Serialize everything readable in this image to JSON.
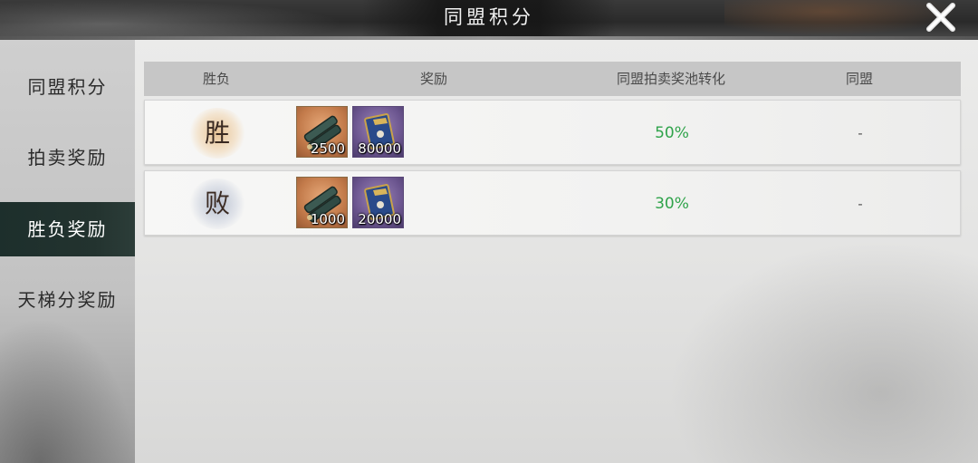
{
  "window": {
    "title": "同盟积分",
    "close_icon": "close-x-icon"
  },
  "sidebar": {
    "items": [
      {
        "label": "同盟积分",
        "active": false
      },
      {
        "label": "拍卖奖励",
        "active": false
      },
      {
        "label": "胜负奖励",
        "active": true
      },
      {
        "label": "天梯分奖励",
        "active": false
      }
    ]
  },
  "table": {
    "headers": [
      "胜负",
      "奖励",
      "同盟拍卖奖池转化",
      "同盟"
    ],
    "rows": [
      {
        "result": "胜",
        "rewards": [
          {
            "icon": "scroll-icon",
            "quantity": "2500"
          },
          {
            "icon": "book-icon",
            "quantity": "80000"
          }
        ],
        "auction_conversion": "50%",
        "alliance": "-"
      },
      {
        "result": "败",
        "rewards": [
          {
            "icon": "scroll-icon",
            "quantity": "1000"
          },
          {
            "icon": "book-icon",
            "quantity": "20000"
          }
        ],
        "auction_conversion": "30%",
        "alliance": "-"
      }
    ]
  },
  "colors": {
    "active_tab": "#1d2f2c",
    "percent_text": "#2fa34a",
    "bronze_item": "#c27a4a",
    "purple_item": "#6c5690"
  }
}
